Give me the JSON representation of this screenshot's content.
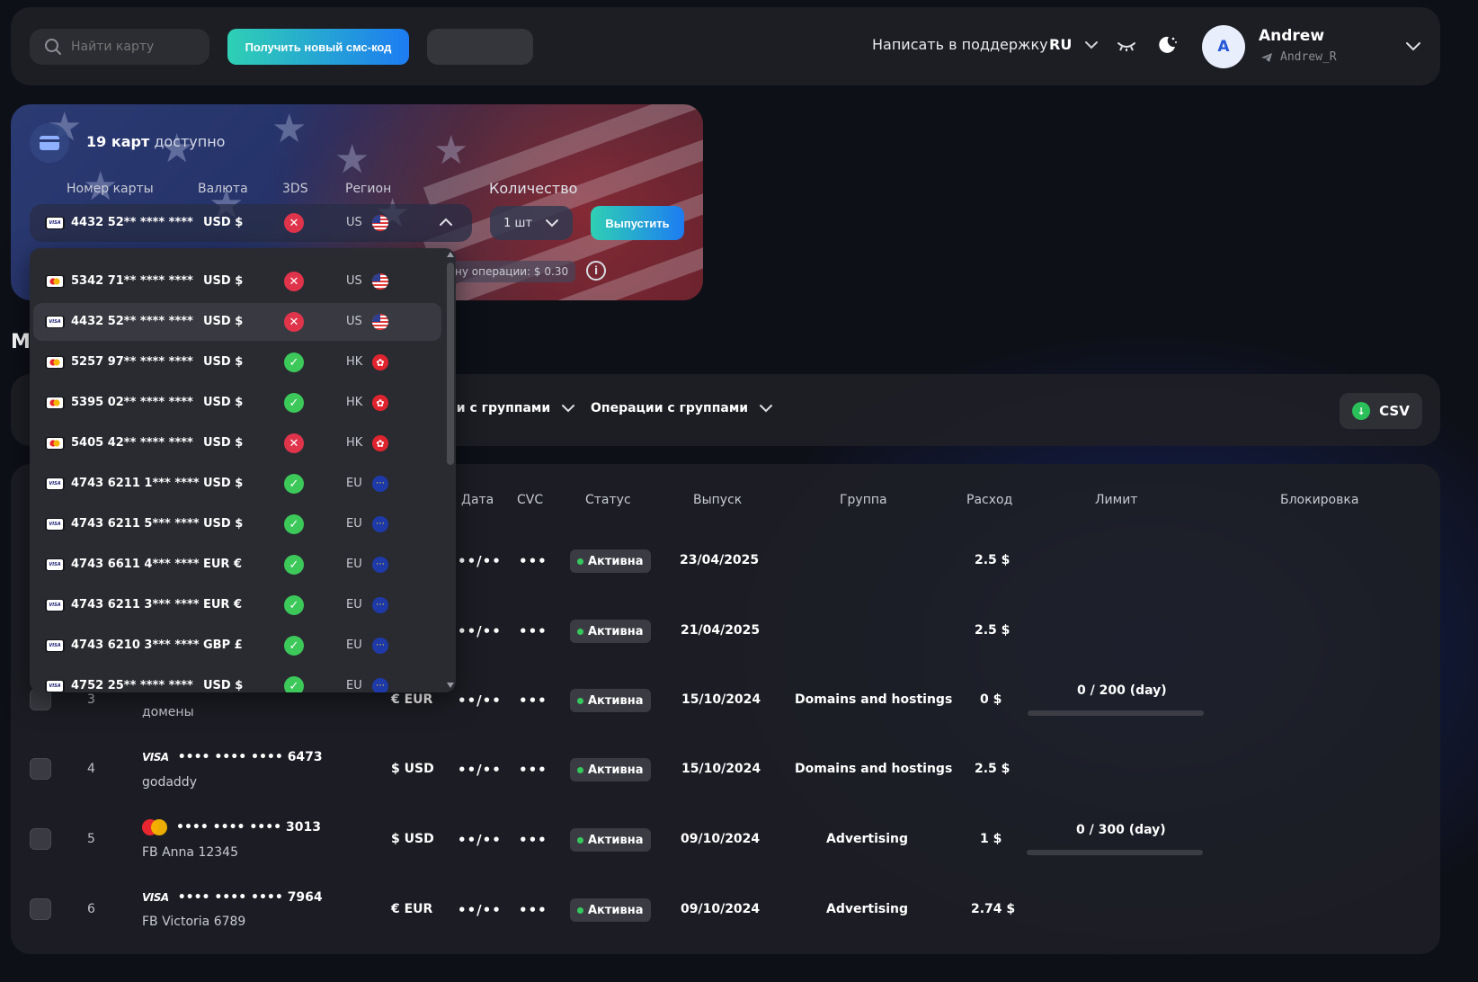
{
  "header": {
    "search_placeholder": "Найти карту",
    "sms_button": "Получить новый смс-код",
    "support_link": "Написать в поддержку",
    "language": "RU",
    "user": {
      "initial": "A",
      "name": "Andrew",
      "handle": "Andrew_R"
    }
  },
  "issue": {
    "available_count": "19 карт",
    "available_suffix": "доступно",
    "columns": {
      "number": "Номер карты",
      "currency": "Валюта",
      "three_ds": "3DS",
      "region": "Регион"
    },
    "selected": {
      "number": "4432 52** **** ****",
      "currency": "USD $",
      "region": "US",
      "brand": "visa",
      "three_ds": false
    },
    "quantity_label": "Количество",
    "quantity_value": "1 шт",
    "issue_button": "Выпустить",
    "fee_text": "ну операции: $ 0.30"
  },
  "dropdown": [
    {
      "number": "5342 71** **** ****",
      "currency": "USD $",
      "three_ds": false,
      "region": "US",
      "flag": "us",
      "brand": "mc"
    },
    {
      "number": "4432 52** **** ****",
      "currency": "USD $",
      "three_ds": false,
      "region": "US",
      "flag": "us",
      "brand": "visa",
      "selected": true
    },
    {
      "number": "5257 97** **** ****",
      "currency": "USD $",
      "three_ds": true,
      "region": "HK",
      "flag": "hk",
      "brand": "mc"
    },
    {
      "number": "5395 02** **** ****",
      "currency": "USD $",
      "three_ds": true,
      "region": "HK",
      "flag": "hk",
      "brand": "mc"
    },
    {
      "number": "5405 42** **** ****",
      "currency": "USD $",
      "three_ds": false,
      "region": "HK",
      "flag": "hk",
      "brand": "mc"
    },
    {
      "number": "4743 6211 1*** ****",
      "currency": "USD $",
      "three_ds": true,
      "region": "EU",
      "flag": "eu",
      "brand": "visa"
    },
    {
      "number": "4743 6211 5*** ****",
      "currency": "USD $",
      "three_ds": true,
      "region": "EU",
      "flag": "eu",
      "brand": "visa"
    },
    {
      "number": "4743 6611 4*** ****",
      "currency": "EUR €",
      "three_ds": true,
      "region": "EU",
      "flag": "eu",
      "brand": "visa"
    },
    {
      "number": "4743 6211 3*** ****",
      "currency": "EUR €",
      "three_ds": true,
      "region": "EU",
      "flag": "eu",
      "brand": "visa"
    },
    {
      "number": "4743 6210 3*** ****",
      "currency": "GBP £",
      "three_ds": true,
      "region": "EU",
      "flag": "eu",
      "brand": "visa"
    },
    {
      "number": "4752 25** **** ****",
      "currency": "USD $",
      "three_ds": true,
      "region": "EU",
      "flag": "eu",
      "brand": "visa"
    }
  ],
  "section_letter": "М",
  "toolbar": {
    "group_ops_1": "ии с группами",
    "group_ops_2": "Операции с группами",
    "csv": "CSV"
  },
  "table": {
    "headers": {
      "date": "Дата",
      "cvc": "CVC",
      "status": "Статус",
      "issued": "Выпуск",
      "group": "Группа",
      "spend": "Расход",
      "limit": "Лимит",
      "block": "Блокировка"
    },
    "rows": [
      {
        "n": "",
        "card": "",
        "name": "",
        "currency": "",
        "date": "••/••",
        "cvc": "•••",
        "status": "Активна",
        "issued": "23/04/2025",
        "group": "",
        "spend": "2.5 $",
        "limit": ""
      },
      {
        "n": "",
        "card": "",
        "name": "",
        "currency": "",
        "date": "••/••",
        "cvc": "•••",
        "status": "Активна",
        "issued": "21/04/2025",
        "group": "",
        "spend": "2.5 $",
        "limit": ""
      },
      {
        "n": "3",
        "card": "",
        "name": "домены",
        "currency": "€ EUR",
        "date": "••/••",
        "cvc": "•••",
        "status": "Активна",
        "issued": "15/10/2024",
        "group": "Domains and hostings",
        "spend": "0 $",
        "limit": "0 / 200 (day)"
      },
      {
        "n": "4",
        "brand": "VISA",
        "card": "•••• •••• •••• 6473",
        "name": "godaddy",
        "currency": "$ USD",
        "date": "••/••",
        "cvc": "•••",
        "status": "Активна",
        "issued": "15/10/2024",
        "group": "Domains and hostings",
        "spend": "2.5 $",
        "limit": ""
      },
      {
        "n": "5",
        "brand": "MC",
        "card": "•••• •••• •••• 3013",
        "name": "FB Anna 12345",
        "currency": "$ USD",
        "date": "••/••",
        "cvc": "•••",
        "status": "Активна",
        "issued": "09/10/2024",
        "group": "Advertising",
        "spend": "1 $",
        "limit": "0 / 300 (day)"
      },
      {
        "n": "6",
        "brand": "VISA",
        "card": "•••• •••• •••• 7964",
        "name": "FB Victoria 6789",
        "currency": "€ EUR",
        "date": "••/••",
        "cvc": "•••",
        "status": "Активна",
        "issued": "09/10/2024",
        "group": "Advertising",
        "spend": "2.74 $",
        "limit": ""
      }
    ]
  }
}
